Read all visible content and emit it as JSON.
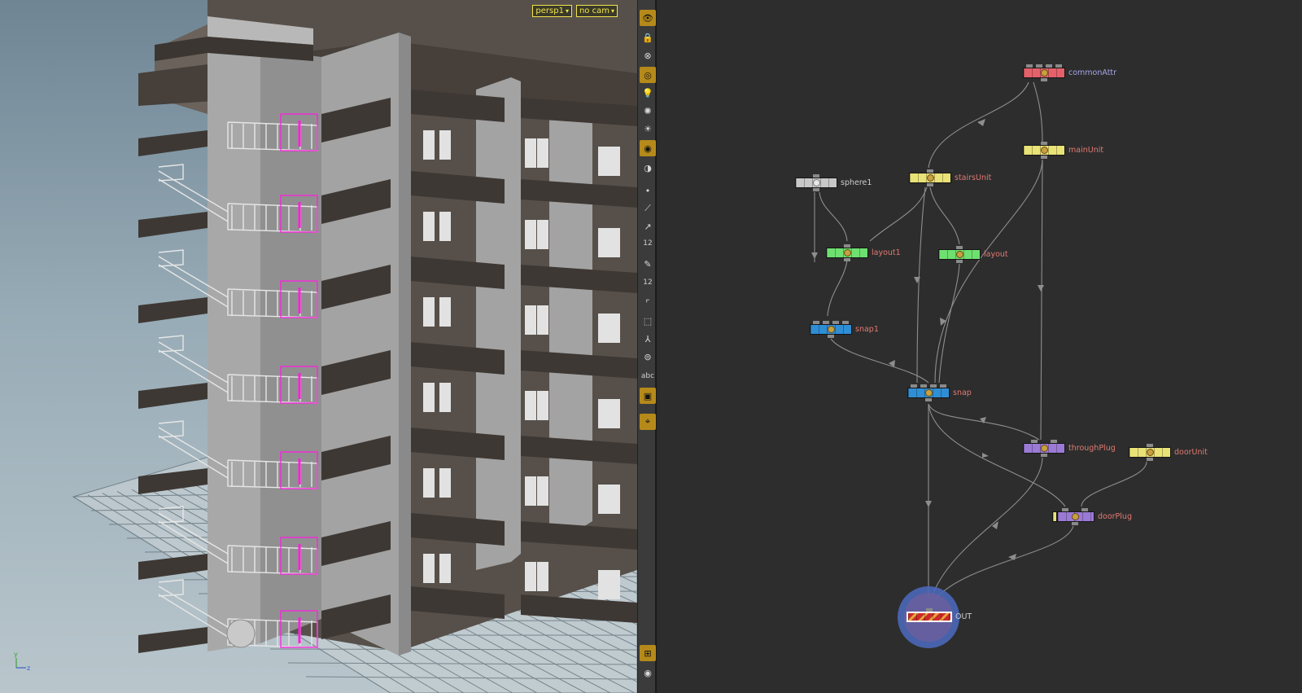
{
  "viewport": {
    "camera_menu": "persp1",
    "camera_option": "no cam",
    "axis_labels": {
      "y": "y",
      "z": "z"
    }
  },
  "toolbar": {
    "label_12_a": "12",
    "label_12_b": "12",
    "label_abc": "abc"
  },
  "network": {
    "nodes": [
      {
        "id": "commonAttr",
        "label": "commonAttr",
        "color": "#e4606a",
        "label_color": "#a7a4e8"
      },
      {
        "id": "mainUnit",
        "label": "mainUnit",
        "color": "#e9e276",
        "label_color": "#e07a72"
      },
      {
        "id": "stairsUnit",
        "label": "stairsUnit",
        "color": "#e9e276",
        "label_color": "#e07a72"
      },
      {
        "id": "sphere1",
        "label": "sphere1",
        "color": "#c8c8c8",
        "label_color": "#cccccc"
      },
      {
        "id": "layout1",
        "label": "layout1",
        "color": "#6ee070",
        "label_color": "#e07a72"
      },
      {
        "id": "layout",
        "label": "layout",
        "color": "#6ee070",
        "label_color": "#e07a72"
      },
      {
        "id": "snap1",
        "label": "snap1",
        "color": "#2f8ed4",
        "label_color": "#e07a72"
      },
      {
        "id": "snap",
        "label": "snap",
        "color": "#2f8ed4",
        "label_color": "#e07a72"
      },
      {
        "id": "throughPlug",
        "label": "throughPlug",
        "color": "#9b7ad6",
        "label_color": "#e07a72"
      },
      {
        "id": "doorUnit",
        "label": "doorUnit",
        "color": "#e9e276",
        "label_color": "#e07a72"
      },
      {
        "id": "doorPlug",
        "label": "doorPlug",
        "color": "#9b7ad6",
        "label_color": "#e07a72"
      },
      {
        "id": "OUT",
        "label": "OUT",
        "color": "#cc2a2a",
        "label_color": "#cccccc"
      }
    ]
  }
}
